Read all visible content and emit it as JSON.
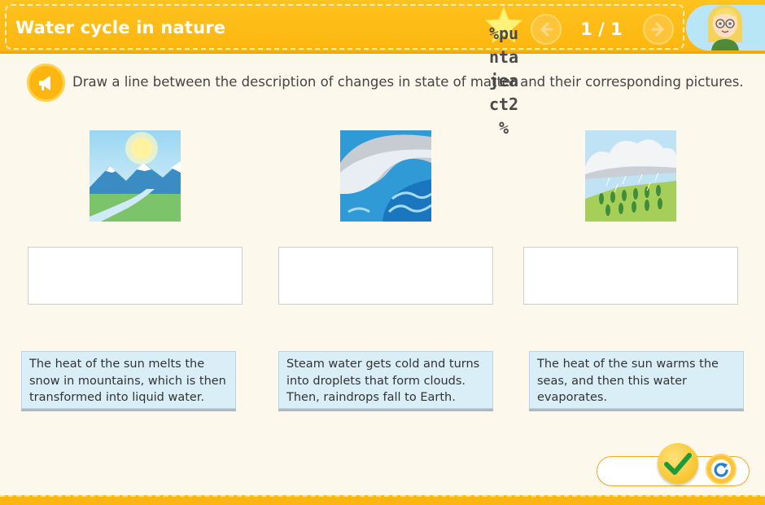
{
  "header": {
    "title": "Water cycle in nature",
    "score_text": "%puntajeact2%",
    "page_counter": "1 / 1",
    "prev_icon": "arrow-left-icon",
    "next_icon": "arrow-right-icon",
    "avatar_icon": "blonde-girl-avatar-icon"
  },
  "instruction": {
    "icon": "megaphone-icon",
    "text": "Draw a line between the description of changes in state of matter and their corresponding pictures."
  },
  "pictures": [
    {
      "depicts": "sun-over-snowy-mountains-with-river"
    },
    {
      "depicts": "ocean-waves"
    },
    {
      "depicts": "rain-clouds-over-fields"
    }
  ],
  "cards": [
    {
      "text": "The heat of the sun melts the snow in mountains, which is then transformed into liquid water."
    },
    {
      "text": "Steam water gets cold and turns into droplets that form clouds. Then, raindrops fall to Earth."
    },
    {
      "text": "The heat of the sun warms the seas, and then this water evaporates."
    }
  ],
  "controls": {
    "check_icon": "checkmark-icon",
    "retry_icon": "retry-icon"
  },
  "colors": {
    "header": "#fdb60f",
    "background": "#fdf8ec",
    "card": "#d9eef7",
    "check_green": "#1f9a3a"
  }
}
